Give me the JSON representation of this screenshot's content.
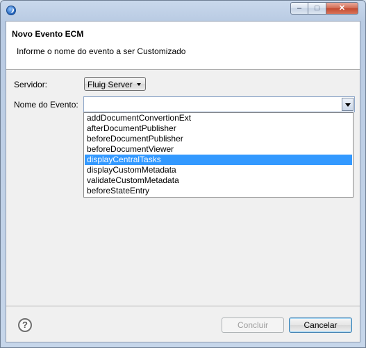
{
  "window": {
    "title": "",
    "controls": {
      "minimize": "–",
      "maximize": "□",
      "close": "✕"
    }
  },
  "header": {
    "title": "Novo Evento ECM",
    "message": "Informe o nome do evento a ser Customizado"
  },
  "form": {
    "server_label": "Servidor:",
    "server_value": "Fluig Server",
    "event_label": "Nome do Evento:",
    "event_value": ""
  },
  "dropdown": {
    "items": [
      "addDocumentConvertionExt",
      "afterDocumentPublisher",
      "beforeDocumentPublisher",
      "beforeDocumentViewer",
      "displayCentralTasks",
      "displayCustomMetadata",
      "validateCustomMetadata",
      "beforeStateEntry"
    ],
    "selected": "displayCentralTasks"
  },
  "footer": {
    "help_glyph": "?",
    "finish_label": "Concluir",
    "cancel_label": "Cancelar"
  },
  "colors": {
    "selection": "#3399ff"
  },
  "icons": [
    "app-icon",
    "help-icon",
    "chevron-down-icon"
  ]
}
